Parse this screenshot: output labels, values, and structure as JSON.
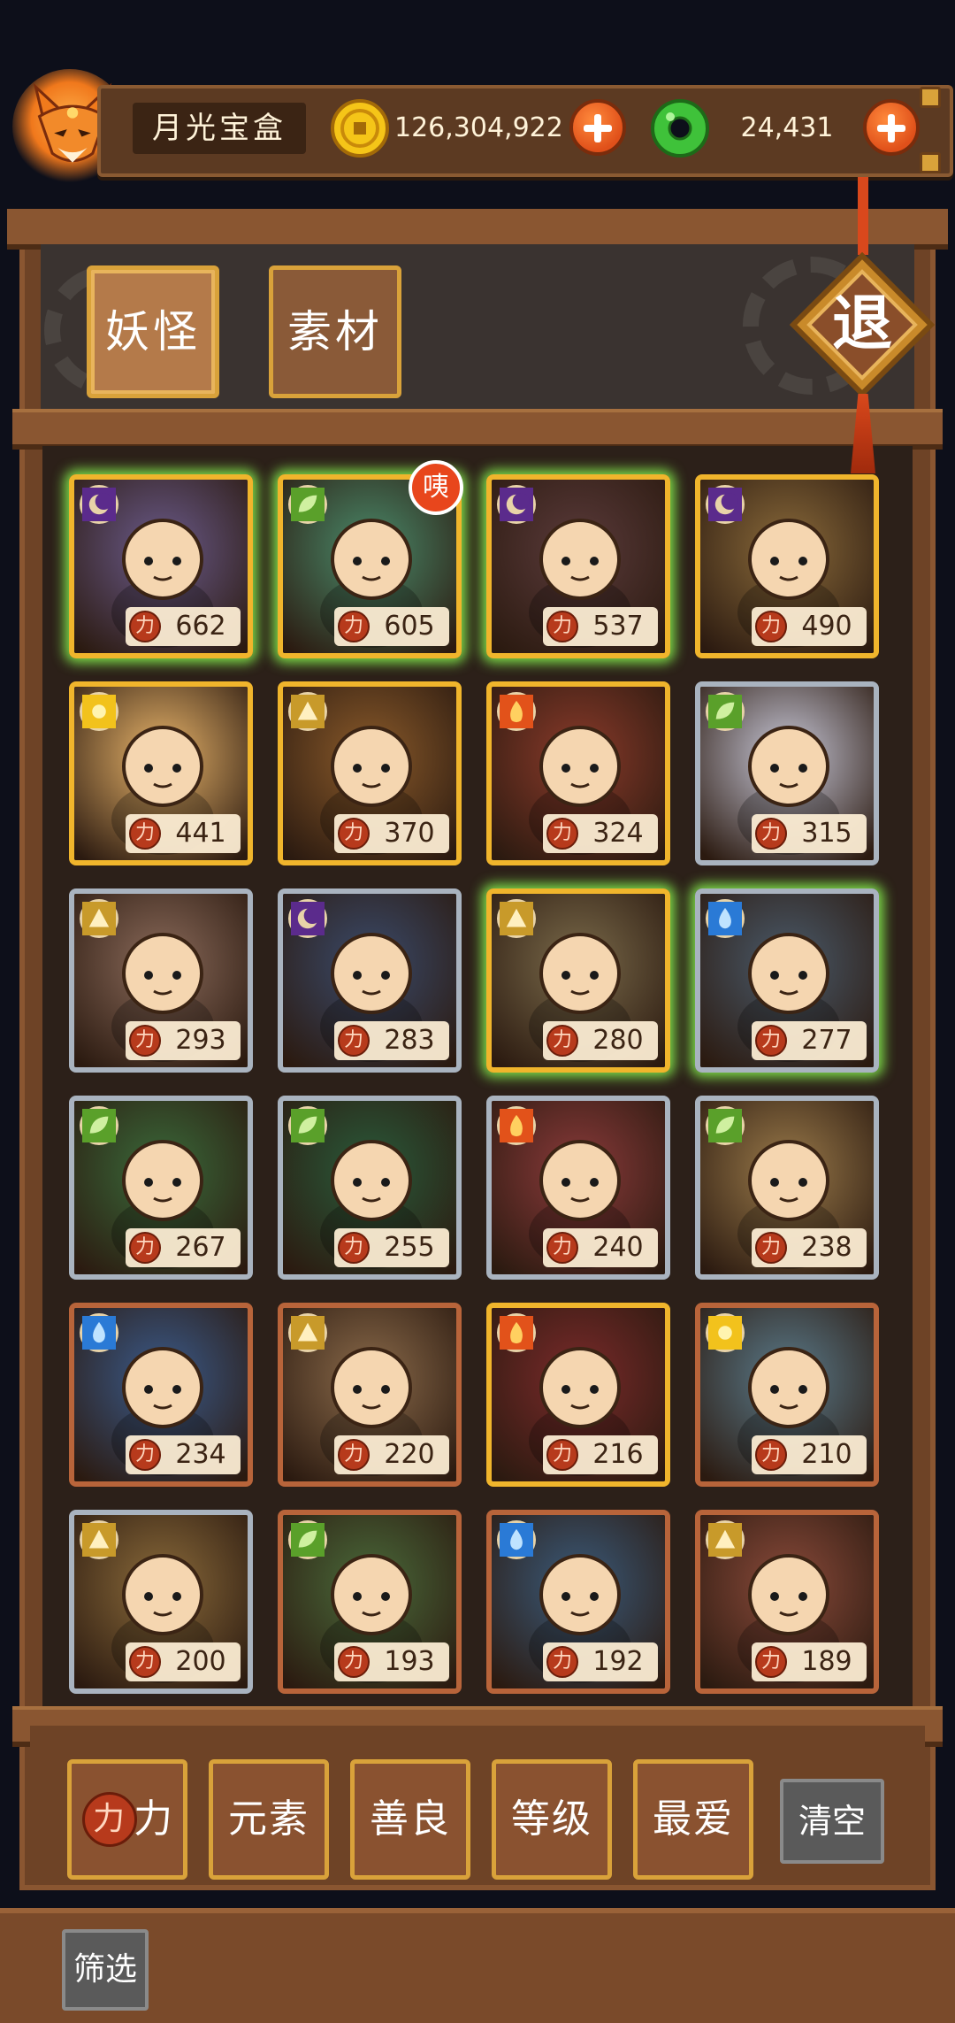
{
  "header": {
    "player_name": "月光宝盒",
    "gold": "126,304,922",
    "jade": "24,431"
  },
  "tabs": [
    {
      "label": "妖怪",
      "active": true
    },
    {
      "label": "素材",
      "active": false
    }
  ],
  "exit_label": "退",
  "new_badge": "咦",
  "cards": [
    {
      "element": "moon",
      "power": "662",
      "frame": "gold",
      "glow": true
    },
    {
      "element": "leaf",
      "power": "605",
      "frame": "gold",
      "glow": true
    },
    {
      "element": "moon",
      "power": "537",
      "frame": "gold",
      "glow": true
    },
    {
      "element": "moon",
      "power": "490",
      "frame": "gold",
      "glow": false
    },
    {
      "element": "sun",
      "power": "441",
      "frame": "gold",
      "glow": false
    },
    {
      "element": "earth",
      "power": "370",
      "frame": "gold",
      "glow": false
    },
    {
      "element": "fire",
      "power": "324",
      "frame": "gold",
      "glow": false
    },
    {
      "element": "leaf",
      "power": "315",
      "frame": "silver",
      "glow": false
    },
    {
      "element": "earth",
      "power": "293",
      "frame": "silver",
      "glow": false
    },
    {
      "element": "moon",
      "power": "283",
      "frame": "silver",
      "glow": false
    },
    {
      "element": "earth",
      "power": "280",
      "frame": "gold",
      "glow": true
    },
    {
      "element": "water",
      "power": "277",
      "frame": "silver",
      "glow": true
    },
    {
      "element": "leaf",
      "power": "267",
      "frame": "silver",
      "glow": false
    },
    {
      "element": "leaf",
      "power": "255",
      "frame": "silver",
      "glow": false
    },
    {
      "element": "fire",
      "power": "240",
      "frame": "silver",
      "glow": false
    },
    {
      "element": "leaf",
      "power": "238",
      "frame": "silver",
      "glow": false
    },
    {
      "element": "water",
      "power": "234",
      "frame": "bronze",
      "glow": false
    },
    {
      "element": "earth",
      "power": "220",
      "frame": "bronze",
      "glow": false
    },
    {
      "element": "fire",
      "power": "216",
      "frame": "gold",
      "glow": false
    },
    {
      "element": "sun",
      "power": "210",
      "frame": "bronze",
      "glow": false
    },
    {
      "element": "earth",
      "power": "200",
      "frame": "silver",
      "glow": false
    },
    {
      "element": "leaf",
      "power": "193",
      "frame": "bronze",
      "glow": false
    },
    {
      "element": "water",
      "power": "192",
      "frame": "bronze",
      "glow": false
    },
    {
      "element": "earth",
      "power": "189",
      "frame": "bronze",
      "glow": false
    }
  ],
  "filters": {
    "power": "力",
    "power_icon": "力",
    "element": "元素",
    "kindness": "善良",
    "level": "等级",
    "favorite": "最爱",
    "clear": "清空"
  },
  "screen_label": "筛选",
  "colors": {
    "moon": "#5b2b8c",
    "leaf": "#5aa02a",
    "sun": "#f2c21c",
    "earth": "#c89a2a",
    "fire": "#e2521a",
    "water": "#2a7ad6"
  }
}
